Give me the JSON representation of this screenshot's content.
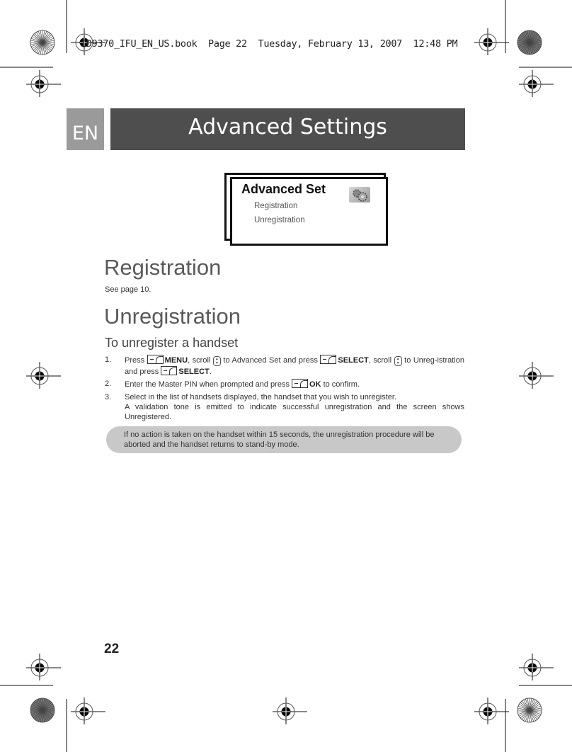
{
  "slug": {
    "text": "ID9370_IFU_EN_US.book  Page 22  Tuesday, February 13, 2007  12:48 PM"
  },
  "header": {
    "language_tab": "EN",
    "title": "Advanced Settings"
  },
  "screen_mock": {
    "title": "Advanced Set",
    "icon": "gear-icon",
    "items": [
      "Registration",
      "Unregistration"
    ]
  },
  "sections": {
    "registration": {
      "heading": "Registration",
      "body": "See page 10."
    },
    "unregistration": {
      "heading": "Unregistration",
      "subheading": "To unregister a handset",
      "steps": [
        {
          "num": "1.",
          "parts": {
            "a": "Press ",
            "menu": "MENU",
            "b": ", scroll ",
            "c": " to Advanced Set and press ",
            "select1": "SELECT",
            "d": ", scroll ",
            "e": " to Unreg-istration and press ",
            "select2": "SELECT",
            "f": "."
          }
        },
        {
          "num": "2.",
          "parts": {
            "a": "Enter the Master PIN when prompted and press ",
            "ok": "OK",
            "b": " to confirm."
          }
        },
        {
          "num": "3.",
          "line1": "Select in the list of handsets displayed, the handset that you wish to unregister.",
          "line2": "A validation tone is emitted to indicate successful unregistration and the screen shows Unregistered."
        }
      ],
      "note": "If no action is taken on the handset within 15 seconds, the unregistration procedure will be aborted and the handset returns to stand-by mode."
    }
  },
  "footer": {
    "page_number": "22"
  },
  "colors": {
    "title_bar": "#4e4e4e",
    "language_tab": "#9a9a9a",
    "note_background": "#c8c8c8",
    "heading_gray": "#5a5a5a"
  }
}
